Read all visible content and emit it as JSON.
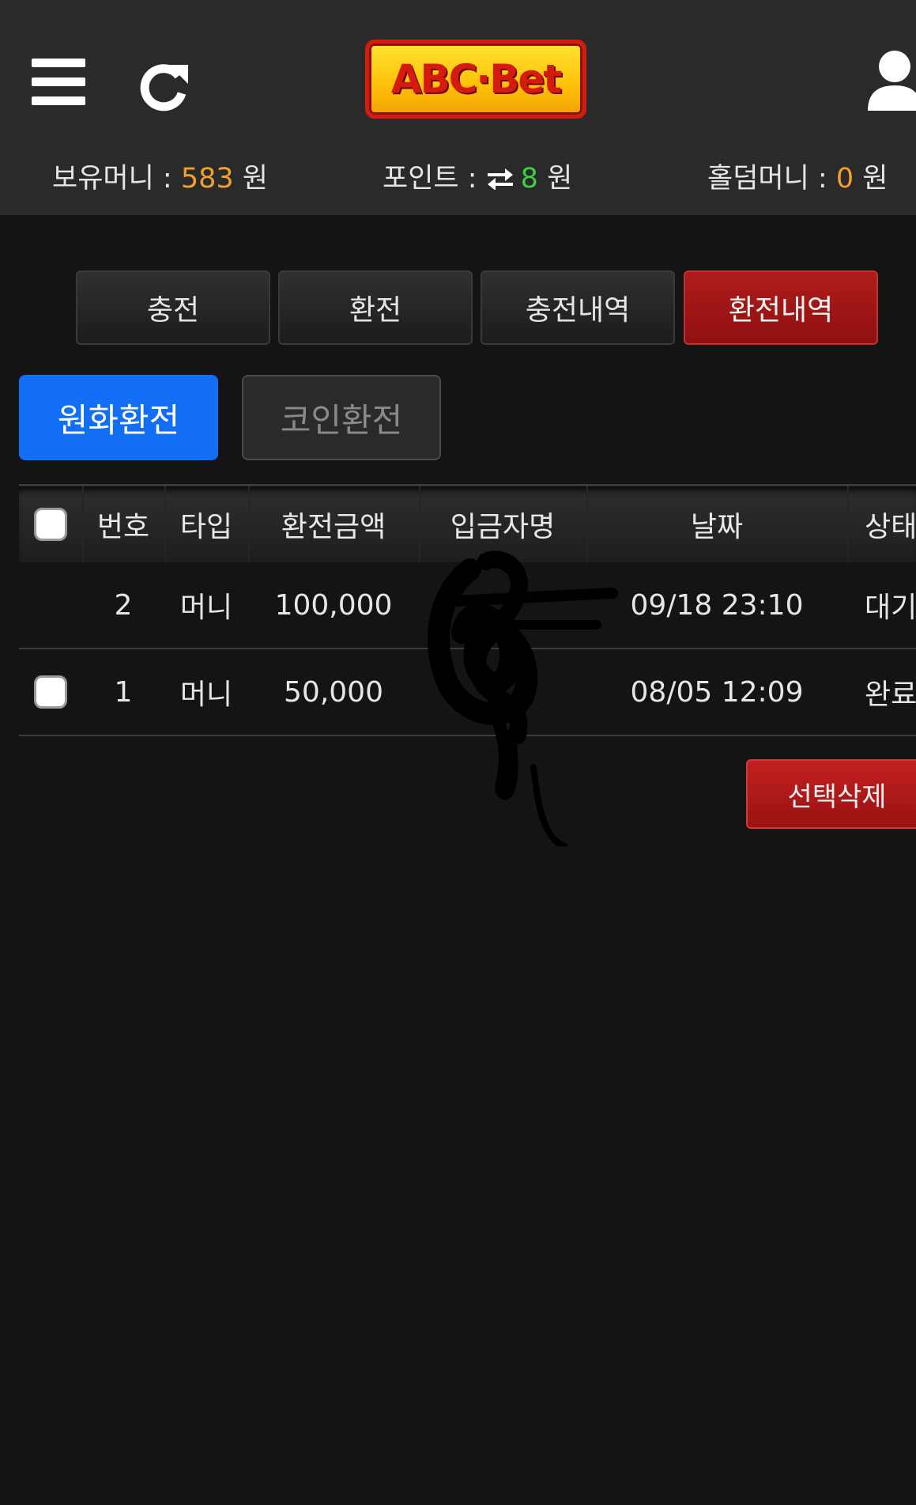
{
  "header": {
    "logo_text": "ABC·Bet",
    "menu_icon": "hamburger-menu-icon",
    "refresh_icon": "refresh-icon",
    "user_icon": "user-icon"
  },
  "balances": {
    "money_label": "보유머니 : ",
    "money_value": "583",
    "money_unit": " 원",
    "point_label": "포인트 : ",
    "point_value": "8",
    "point_unit": " 원",
    "hold_label": "홀덤머니 : ",
    "hold_value": "0",
    "hold_unit": " 원"
  },
  "tabs": [
    {
      "label": "충전",
      "active": false
    },
    {
      "label": "환전",
      "active": false
    },
    {
      "label": "충전내역",
      "active": false
    },
    {
      "label": "환전내역",
      "active": true
    }
  ],
  "subtabs": {
    "krw": "원화환전",
    "coin": "코인환전"
  },
  "table": {
    "headers": {
      "no": "번호",
      "type": "타입",
      "amount": "환전금액",
      "name": "입금자명",
      "date": "날짜",
      "status": "상태"
    },
    "rows": [
      {
        "no": "2",
        "type": "머니",
        "amount": "100,000",
        "name": "",
        "date": "09/18 23:10",
        "status": "대기",
        "has_checkbox": false
      },
      {
        "no": "1",
        "type": "머니",
        "amount": "50,000",
        "name": "",
        "date": "08/05 12:09",
        "status": "완료",
        "has_checkbox": true
      }
    ]
  },
  "actions": {
    "delete_label": "선택삭제"
  },
  "colors": {
    "accent_blue": "#136ef6",
    "active_red": "#a81818",
    "money_orange": "#f0a030",
    "point_green": "#3fcf43",
    "background": "#141414",
    "header_bg": "#2a2a2a"
  }
}
